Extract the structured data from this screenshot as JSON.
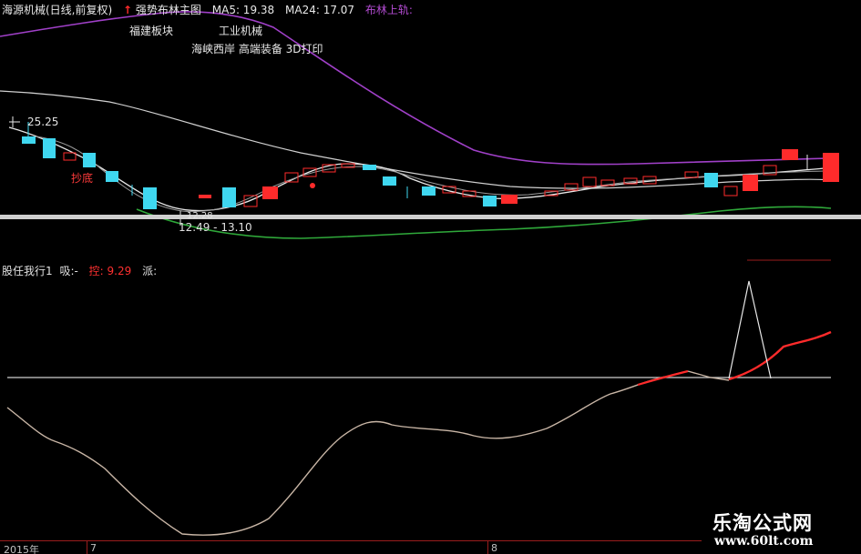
{
  "header": {
    "symbol": "海源机械(日线,前复权)",
    "arrow": "↑",
    "studio": "强势布林主图",
    "ma5_label": "MA5: 19.38",
    "ma24_label": "MA24: 17.07",
    "boll_label": "布林上轨: ",
    "sector_1": "福建板块",
    "sector_2": "工业机械",
    "sector_3": "海峡西岸 高端装备 3D打印"
  },
  "price_panel": {
    "high_label": "25.25",
    "low_label": "12.49 - 13.10",
    "low_small": "12.28",
    "signal_label": "抄底"
  },
  "indicator_panel": {
    "name": "股任我行1",
    "x_label": "吸:-",
    "k_label": "控: 9.29",
    "p_label": "派:"
  },
  "xaxis": {
    "year": "2015年",
    "m7": "7",
    "m8": "8"
  },
  "watermark": {
    "line1": "乐淘公式网",
    "line2": "www.60lt.com"
  },
  "colors": {
    "up": "#ff2b2b",
    "down": "#3fd7f0",
    "ma": "#d8d8d8",
    "upper": "#a040c8",
    "lower": "#2fa83a",
    "curve": "#c9b6a6",
    "curve_hot": "#ff2b2b"
  }
}
